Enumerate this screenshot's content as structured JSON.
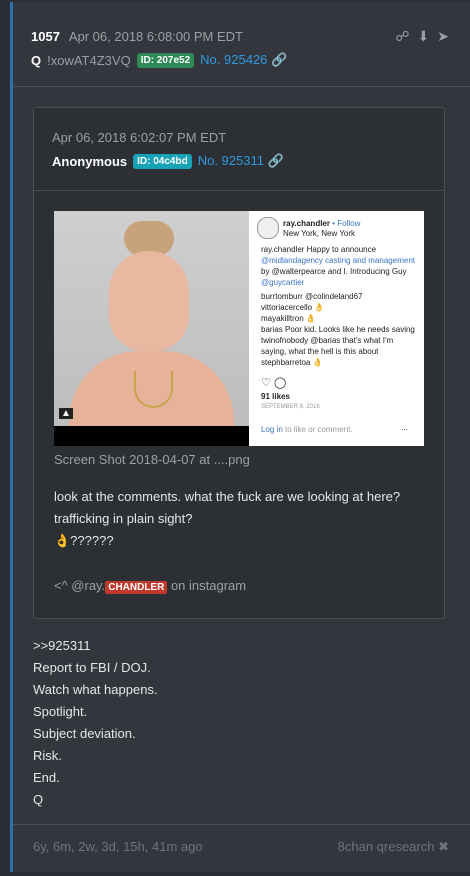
{
  "post": {
    "number": "1057",
    "date": "Apr 06, 2018 6:08:00 PM EDT",
    "author": "Q",
    "tripcode": "!xowAT4Z3VQ",
    "id_badge": "ID: 207e52",
    "link": "No. 925426",
    "icons": [
      "share-icon",
      "download-icon",
      "forward-icon"
    ]
  },
  "quote": {
    "date": "Apr 06, 2018 6:02:07 PM EDT",
    "author": "Anonymous",
    "id_badge": "ID: 04c4bd",
    "link": "No. 925311",
    "filename": "Screen Shot 2018-04-07 at ....png",
    "message_lines": [
      "look at the comments. what the fuck are we looking at here?",
      "trafficking in plain sight?",
      "👌??????"
    ],
    "social_prefix": "<^ @ray.",
    "social_badge": "CHANDLER",
    "social_suffix": " on instagram",
    "instagram": {
      "user": "ray.chandler",
      "follow": "• Follow",
      "location": "New York, New York",
      "caption": "ray.chandler Happy to announce",
      "caption2": "@midlandagency casting and management",
      "caption3": "by @walterpearce and I. Introducing Guy",
      "caption4": "@guycartier",
      "comments": [
        "burrtomburr @colindeland67",
        "vittoriacercello 👌",
        "mayakilltron 👌",
        "barias Poor kid. Looks like he needs saving",
        "twinofnobody @barias that's what I'm",
        "saying, what the hell is this about",
        "stephbarretoa 👌"
      ],
      "likes": "91 likes",
      "posted": "SEPTEMBER 8, 2016",
      "login": "Log in",
      "login_suffix": " to like or comment.",
      "more": "..."
    }
  },
  "body_lines": [
    ">>925311",
    "Report to FBI / DOJ.",
    "Watch what happens.",
    "Spotlight.",
    "Subject deviation.",
    "Risk.",
    "End.",
    "Q"
  ],
  "footer": {
    "ago": "6y, 6m, 2w, 3d, 15h, 41m ago",
    "source": "8chan qresearch"
  }
}
